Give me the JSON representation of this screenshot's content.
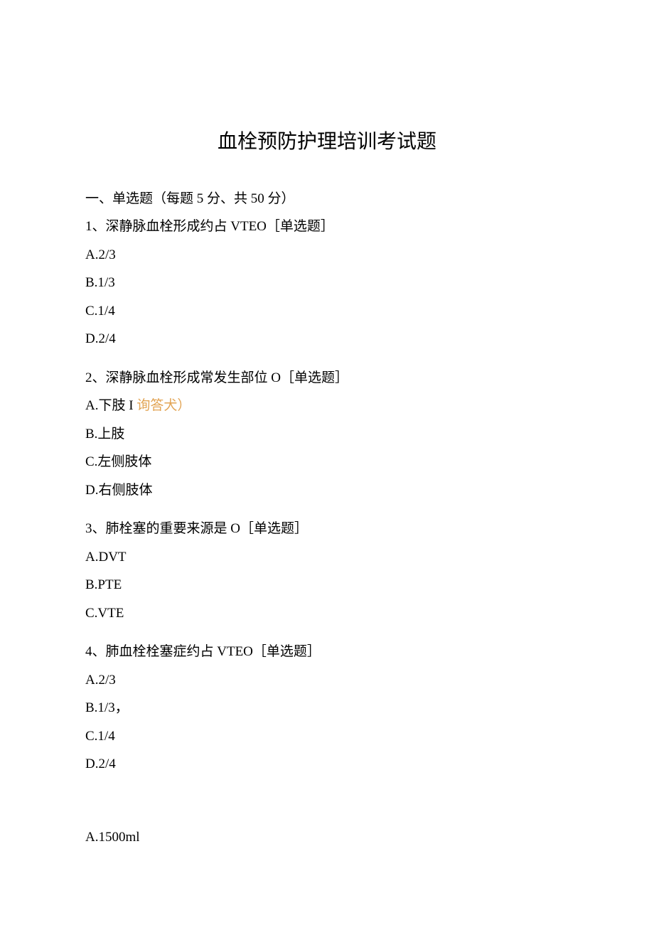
{
  "title": "血栓预防护理培训考试题",
  "section_header": "一、单选题（每题 5 分、共 50 分）",
  "questions": [
    {
      "text": "1、深静脉血栓形成约占 VTEO［单选题］",
      "options": [
        "A.2/3",
        "B.1/3",
        "C.1/4",
        "D.2/4"
      ]
    },
    {
      "text": "2、深静脉血栓形成常发生部位 O［单选题］",
      "options": [
        "A.下肢 I 询答犬）",
        "B.上肢",
        "C.左侧肢体",
        "D.右侧肢体"
      ],
      "answer_index": 0,
      "answer_prefix": "A.下肢 I ",
      "answer_marker": "询答犬）"
    },
    {
      "text": "3、肺栓塞的重要来源是 O［单选题］",
      "options": [
        "A.DVT",
        "B.PTE",
        "C.VTE"
      ]
    },
    {
      "text": "4、肺血栓栓塞症约占 VTEO［单选题］",
      "options": [
        "A.2/3",
        "B.1/3，",
        "C.1/4",
        "D.2/4"
      ]
    }
  ],
  "partial_option": "A.1500ml"
}
